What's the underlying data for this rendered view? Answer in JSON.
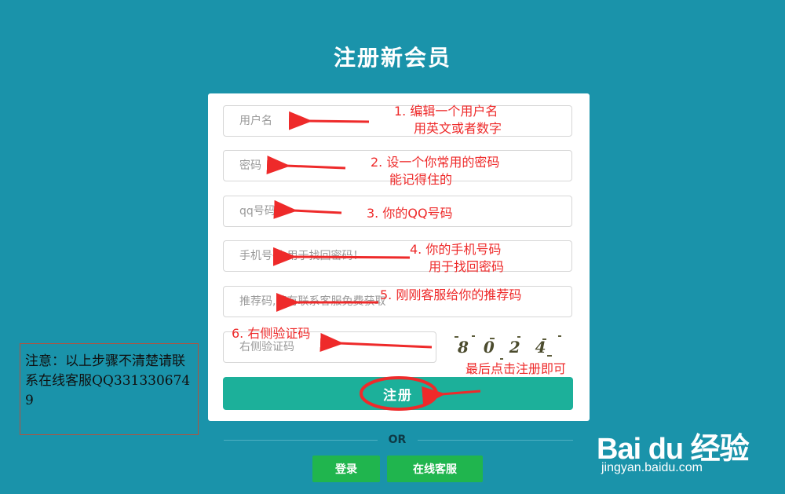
{
  "page": {
    "title": "注册新会员"
  },
  "form": {
    "username_placeholder": "用户名",
    "password_placeholder": "密码",
    "qq_placeholder": "qq号码",
    "phone_placeholder": "手机号码 用于找回密码！",
    "referral_placeholder": "推荐码,若有联系客服免费获取",
    "captcha_placeholder": "右侧验证码",
    "captcha_text": "8 0 2 4",
    "register_label": "注册"
  },
  "divider": {
    "or_label": "OR"
  },
  "footer_buttons": {
    "login_label": "登录",
    "support_label": "在线客服"
  },
  "annotations": {
    "a1_line1": "1. 编辑一个用户名",
    "a1_line2": "用英文或者数字",
    "a2_line1": "2. 设一个你常用的密码",
    "a2_line2": "能记得住的",
    "a3": "3. 你的QQ号码",
    "a4_line1": "4. 你的手机号码",
    "a4_line2": "用于找回密码",
    "a5": "5. 刚刚客服给你的推荐码",
    "a6": "6. 右侧验证码",
    "final": "最后点击注册即可"
  },
  "note": {
    "text": "注意：以上步骤不清楚请联系在线客服QQ3313306749"
  },
  "watermark": {
    "logo_text": "Bai du 经验",
    "url": "jingyan.baidu.com"
  },
  "colors": {
    "background": "#1a93aa",
    "register_button": "#1cb09a",
    "small_buttons": "#20b54e",
    "annotation_red": "#ee2a2a"
  }
}
